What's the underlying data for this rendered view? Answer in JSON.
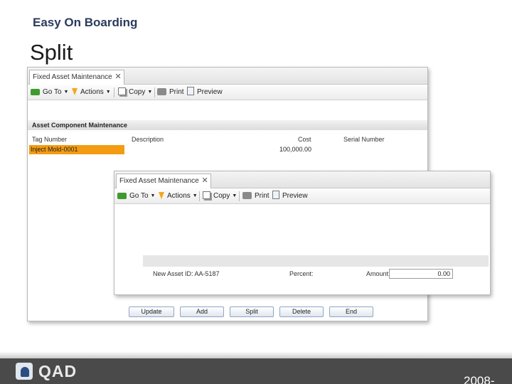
{
  "slide": {
    "header": "Easy On Boarding",
    "title": "Split"
  },
  "back_window": {
    "tab_label": "Fixed Asset Maintenance",
    "toolbar": {
      "goto": "Go To",
      "actions": "Actions",
      "copy": "Copy",
      "print": "Print",
      "preview": "Preview"
    },
    "section_title": "Asset Component Maintenance",
    "columns": [
      "Tag Number",
      "Description",
      "Cost",
      "Serial Number"
    ],
    "rows": [
      {
        "tag": "Inject Mold-0001",
        "description": "",
        "cost": "100,000.00",
        "serial": ""
      }
    ],
    "buttons": [
      "Update",
      "Add",
      "Split",
      "Delete",
      "End"
    ]
  },
  "front_window": {
    "tab_label": "Fixed Asset Maintenance",
    "toolbar": {
      "goto": "Go To",
      "actions": "Actions",
      "copy": "Copy",
      "print": "Print",
      "preview": "Preview"
    },
    "form": {
      "new_asset_label": "New Asset ID: AA-5187",
      "percent_label": "Percent:",
      "amount_label": "Amount:",
      "amount_value": "0.00"
    }
  },
  "footer": {
    "logo_text": "QAD",
    "year": "2008-"
  },
  "colors": {
    "highlight": "#f39c12",
    "footer_bg": "#4a4a4a"
  },
  "icons": [
    "go-to-icon",
    "actions-icon",
    "copy-icon",
    "print-icon",
    "preview-icon",
    "close-icon",
    "qad-logo"
  ]
}
